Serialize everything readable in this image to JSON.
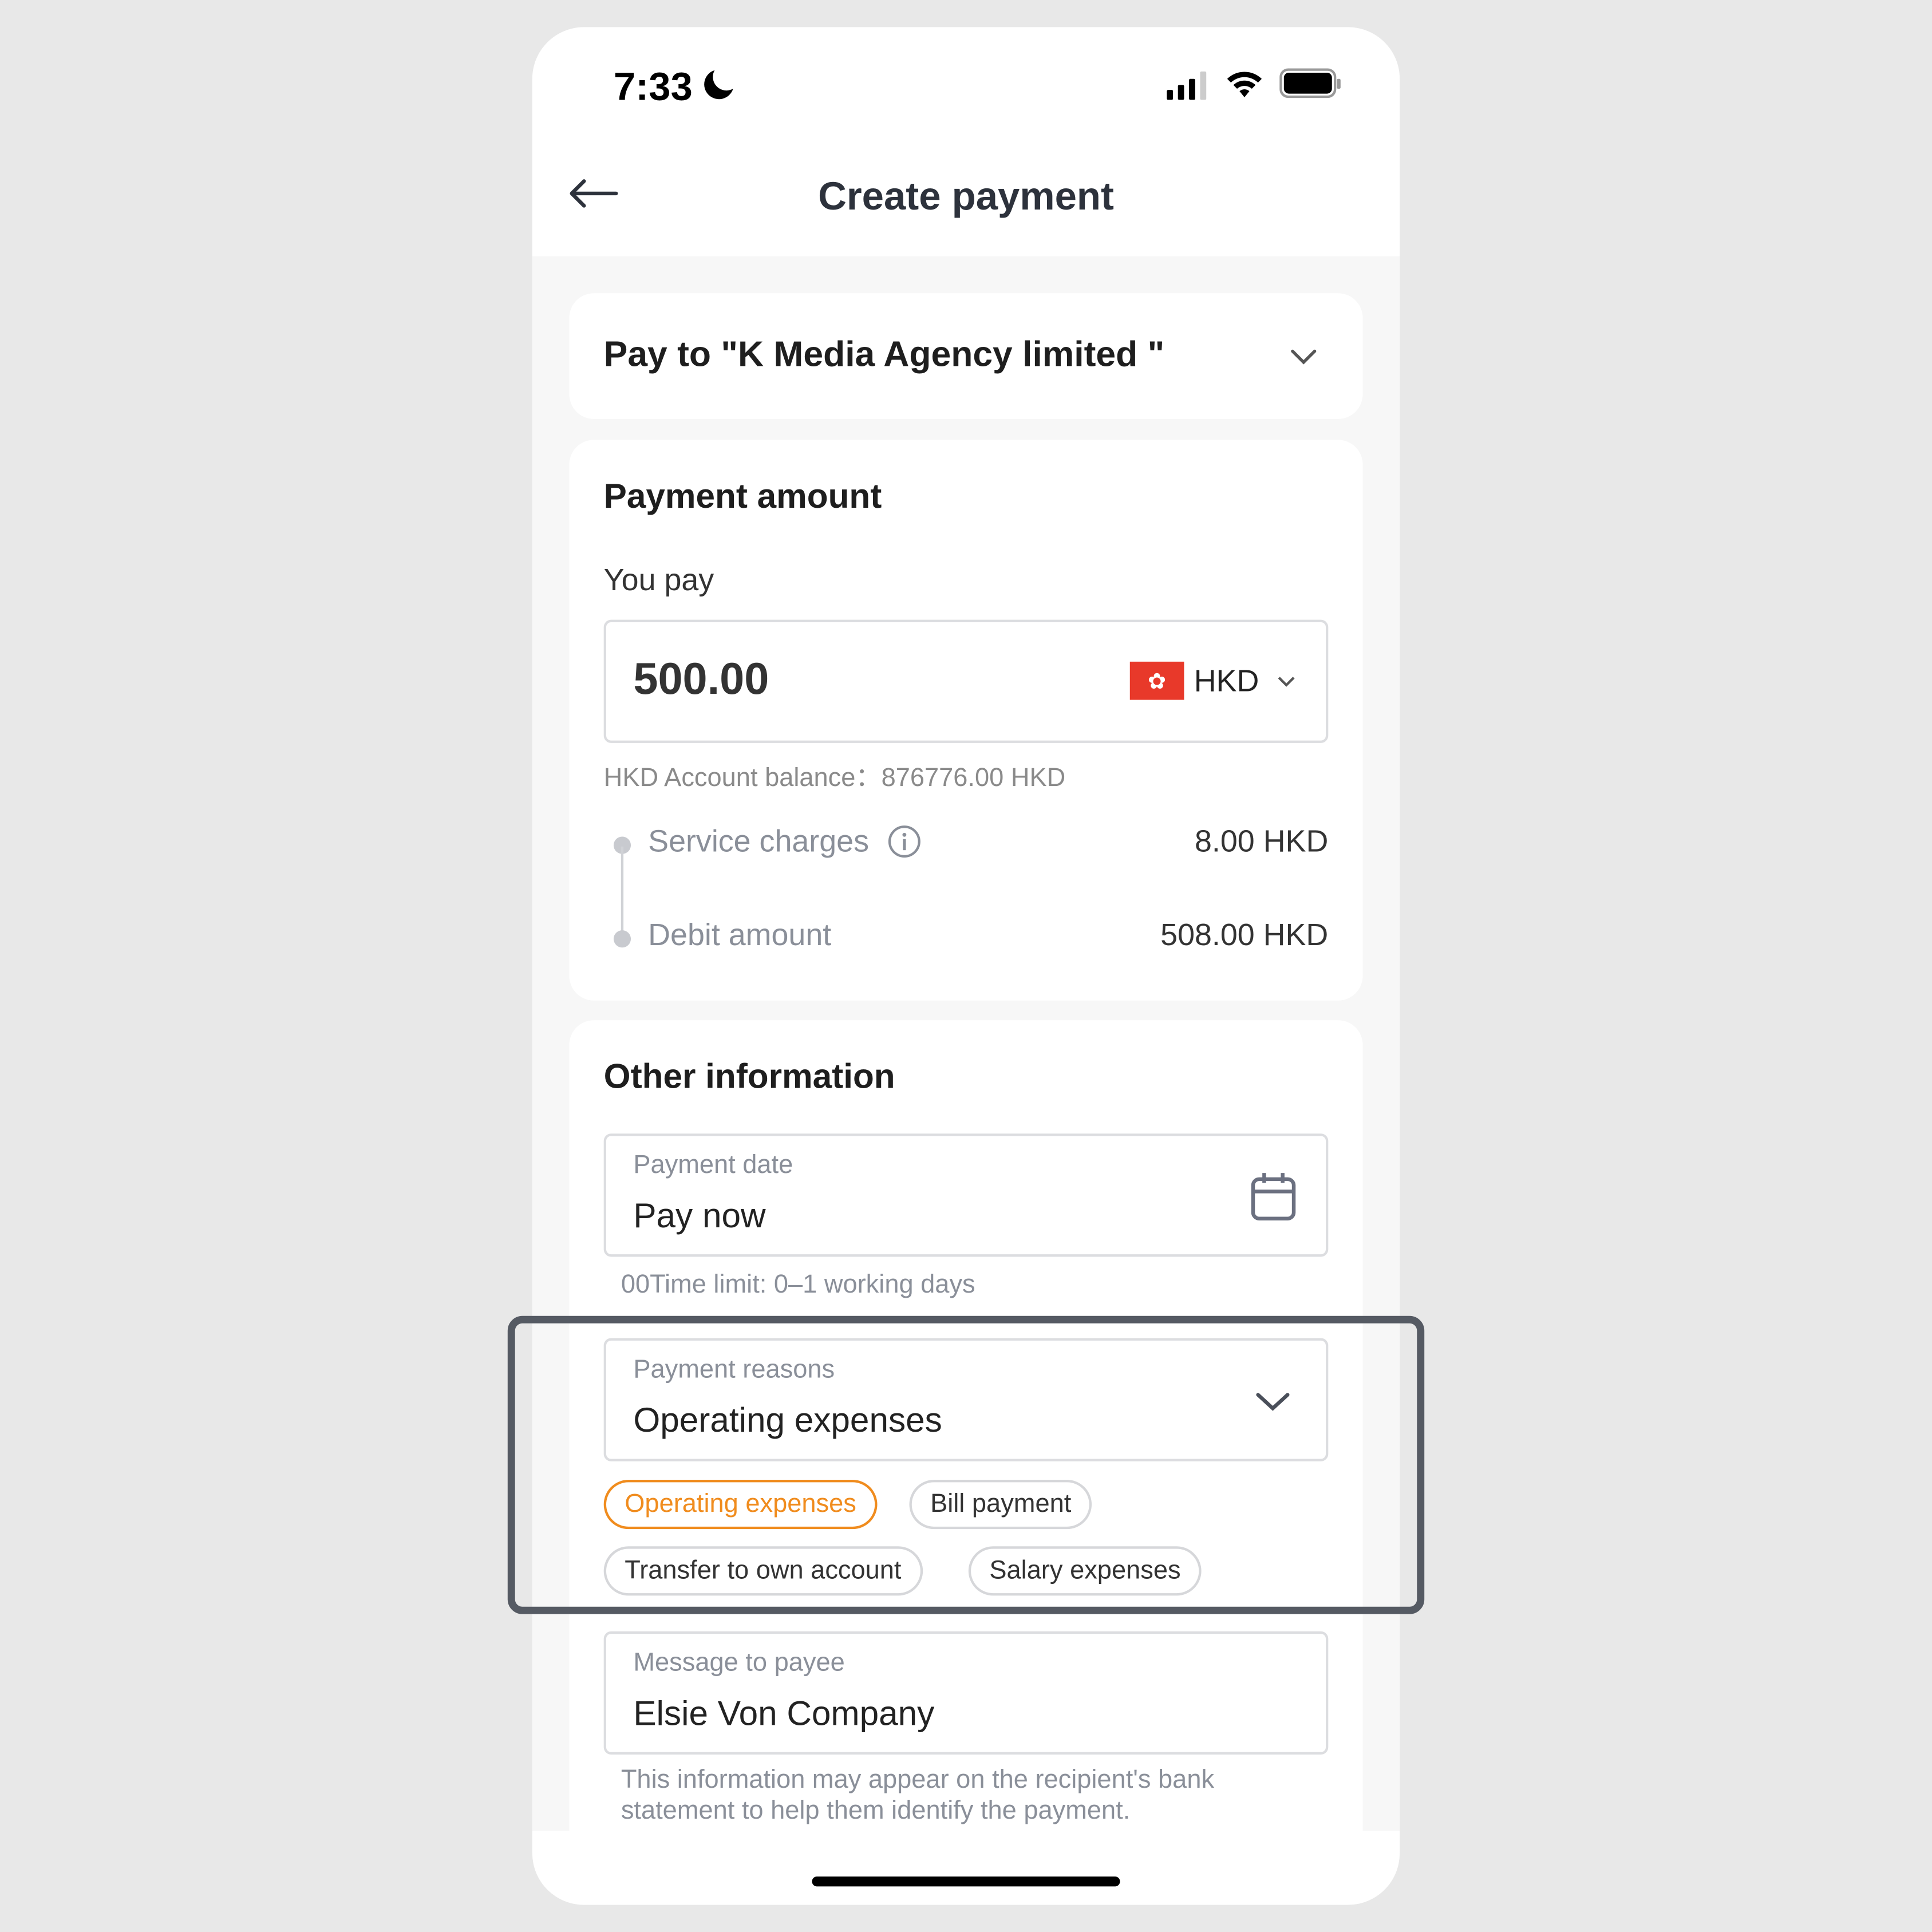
{
  "status_bar": {
    "time": "7:33",
    "icons": [
      "moon-icon",
      "signal-icon",
      "wifi-icon",
      "battery-icon"
    ]
  },
  "header": {
    "title": "Create payment",
    "back_icon": "arrow-left-icon"
  },
  "payee": {
    "label": "Pay to \"K Media Agency limited \""
  },
  "amount": {
    "section_title": "Payment amount",
    "you_pay_label": "You pay",
    "value": "500.00",
    "currency": "HKD",
    "balance": "HKD Account balance：876776.00 HKD",
    "service_charges_label": "Service charges",
    "service_charges_value": "8.00 HKD",
    "debit_label": "Debit amount",
    "debit_value": "508.00 HKD"
  },
  "other": {
    "section_title": "Other information",
    "payment_date_label": "Payment date",
    "payment_date_value": "Pay now",
    "time_limit": "00Time limit: 0–1 working days",
    "reasons_label": "Payment reasons",
    "reasons_value": "Operating expenses",
    "reason_chips": [
      "Operating expenses",
      "Bill payment",
      "Transfer to own account",
      "Salary expenses"
    ],
    "message_label": "Message to payee",
    "message_value": "Elsie Von Company",
    "message_hint_1": "This information may appear on the recipient's bank",
    "message_hint_2": "statement to help them identify the payment."
  },
  "colors": {
    "accent": "#f08c1e",
    "flag_red": "#e8392a",
    "highlight_border": "#555a63"
  }
}
